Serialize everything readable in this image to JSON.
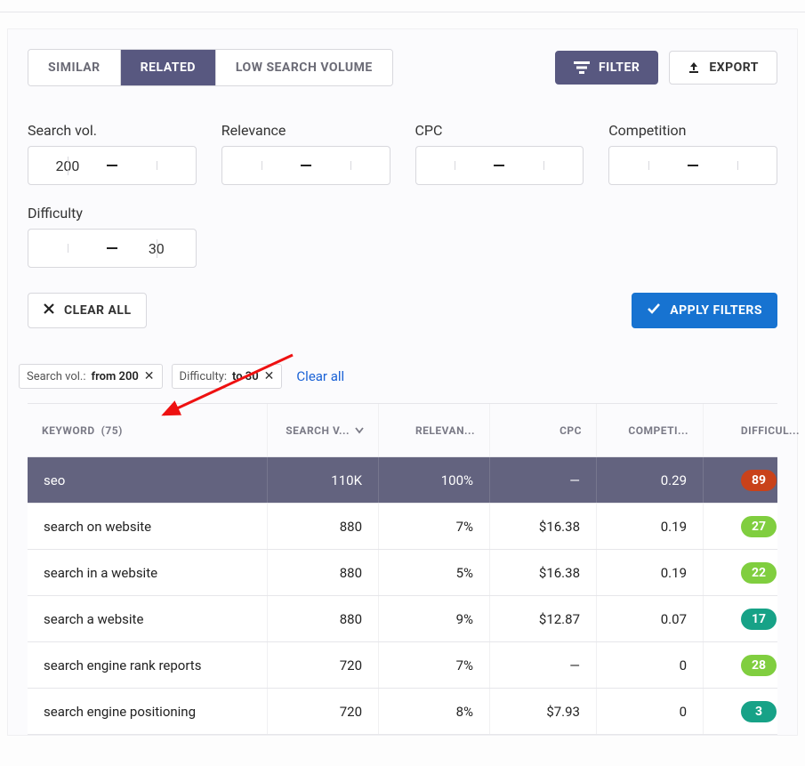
{
  "tabs": {
    "similar": "SIMILAR",
    "related": "RELATED",
    "low_search": "LOW SEARCH VOLUME",
    "active": "related"
  },
  "buttons": {
    "filter": "FILTER",
    "export": "EXPORT",
    "clear_all": "CLEAR ALL",
    "apply": "APPLY FILTERS"
  },
  "filters": {
    "search_vol": {
      "label": "Search vol.",
      "from": "200",
      "to": ""
    },
    "relevance": {
      "label": "Relevance",
      "from": "",
      "to": ""
    },
    "cpc": {
      "label": "CPC",
      "from": "",
      "to": ""
    },
    "competition": {
      "label": "Competition",
      "from": "",
      "to": ""
    },
    "difficulty": {
      "label": "Difficulty",
      "from": "",
      "to": "30"
    }
  },
  "chips": {
    "sv": {
      "label": "Search vol.:",
      "value": "from 200"
    },
    "df": {
      "label": "Difficulty:",
      "value": "to 30"
    },
    "clear_all": "Clear all"
  },
  "table": {
    "count": "75",
    "headers": {
      "keyword": "KEYWORD",
      "search_vol": "SEARCH V...",
      "relevance": "RELEVAN...",
      "cpc": "CPC",
      "competition": "COMPETI...",
      "difficulty": "DIFFICUL..."
    },
    "rows": [
      {
        "keyword": "seo",
        "search_vol": "110K",
        "relevance": "100%",
        "cpc": "—",
        "competition": "0.29",
        "difficulty": "89",
        "diff_color": "#c9421a",
        "highlight": true
      },
      {
        "keyword": "search on website",
        "search_vol": "880",
        "relevance": "7%",
        "cpc": "$16.38",
        "competition": "0.19",
        "difficulty": "27",
        "diff_color": "#80ce3f"
      },
      {
        "keyword": "search in a website",
        "search_vol": "880",
        "relevance": "5%",
        "cpc": "$16.38",
        "competition": "0.19",
        "difficulty": "22",
        "diff_color": "#80ce3f"
      },
      {
        "keyword": "search a website",
        "search_vol": "880",
        "relevance": "9%",
        "cpc": "$12.87",
        "competition": "0.07",
        "difficulty": "17",
        "diff_color": "#17a287"
      },
      {
        "keyword": "search engine rank reports",
        "search_vol": "720",
        "relevance": "7%",
        "cpc": "—",
        "competition": "0",
        "difficulty": "28",
        "diff_color": "#80ce3f"
      },
      {
        "keyword": "search engine positioning",
        "search_vol": "720",
        "relevance": "8%",
        "cpc": "$7.93",
        "competition": "0",
        "difficulty": "3",
        "diff_color": "#17a287"
      }
    ]
  },
  "colors": {
    "accent_purple": "#585880",
    "accent_blue": "#1773d1"
  }
}
